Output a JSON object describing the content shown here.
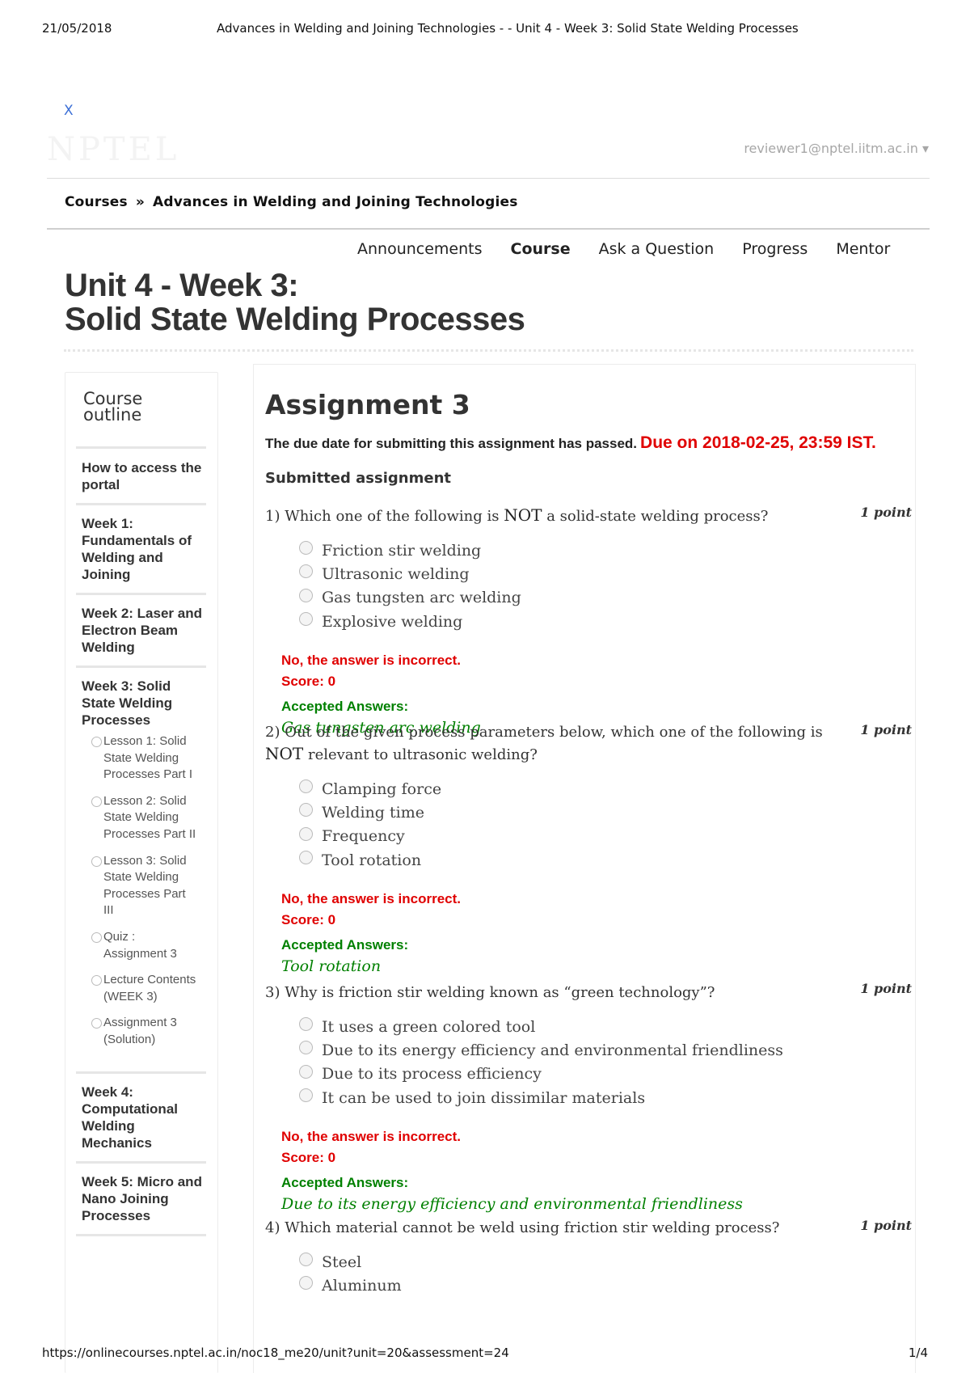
{
  "print_header": {
    "date": "21/05/2018",
    "title": "Advances in Welding and Joining Technologies - - Unit 4 - Week 3: Solid State Welding Processes"
  },
  "header": {
    "close": "X",
    "logo": "NPTEL",
    "user": "reviewer1@nptel.iitm.ac.in ▾"
  },
  "breadcrumb": {
    "root": "Courses",
    "sep": "»",
    "course": "Advances in Welding and Joining Technologies"
  },
  "nav": {
    "tabs": [
      "Announcements",
      "Course",
      "Ask a Question",
      "Progress",
      "Mentor"
    ],
    "active": "Course"
  },
  "page_title": {
    "line1": "Unit 4 - Week 3:",
    "line2": "Solid State Welding Processes"
  },
  "sidebar": {
    "title_line1": "Course",
    "title_line2": "outline",
    "items": [
      {
        "label": "How to access the portal"
      },
      {
        "label": "Week 1: Fundamentals of Welding and Joining"
      },
      {
        "label": "Week 2: Laser and Electron Beam Welding"
      },
      {
        "label": "Week 3: Solid State Welding Processes"
      },
      {
        "label": "Week 4: Computational Welding Mechanics"
      },
      {
        "label": "Week 5: Micro and Nano Joining Processes"
      }
    ],
    "week3_lessons": [
      "Lesson 1: Solid State Welding Processes Part I",
      "Lesson 2: Solid State Welding Processes Part II",
      "Lesson 3: Solid State Welding Processes Part III",
      "Quiz : Assignment 3",
      "Lecture Contents (WEEK 3)",
      "Assignment 3 (Solution)"
    ]
  },
  "assignment": {
    "heading": "Assignment 3",
    "due_passed": "The due date for submitting this assignment has passed.",
    "due_date": "Due on 2018-02-25, 23:59 IST.",
    "submitted": "Submitted assignment",
    "incorrect": "No, the answer is incorrect.",
    "score": "Score: 0",
    "accepted_label": "Accepted Answers:",
    "questions": [
      {
        "pre": "1) Which one of the following is ",
        "em": "NOT",
        "post": " a solid-state welding process?",
        "points": "1 point",
        "options": [
          "Friction stir welding",
          "Ultrasonic welding",
          "Gas tungsten arc welding",
          "Explosive welding"
        ],
        "answer": "Gas tungsten arc welding"
      },
      {
        "pre": "2) Out of the given process parameters below, which one of the following is ",
        "em": "NOT",
        "post": " relevant to ultrasonic welding?",
        "points": "1 point",
        "options": [
          "Clamping force",
          "Welding time",
          "Frequency",
          "Tool rotation"
        ],
        "answer": "Tool rotation"
      },
      {
        "pre": "3) Why is friction stir welding known as “green technology”?",
        "em": "",
        "post": "",
        "points": "1 point",
        "options": [
          "It uses a green colored tool",
          "Due to its energy efficiency and environmental friendliness",
          "Due to its process efficiency",
          "It can be used to join dissimilar materials"
        ],
        "answer": "Due to its energy efficiency and environmental friendliness"
      },
      {
        "pre": "4) Which material cannot be weld using friction stir welding process?",
        "em": "",
        "post": "",
        "points": "1 point",
        "options": [
          "Steel",
          "Aluminum"
        ]
      }
    ]
  },
  "print_footer": {
    "url": "https://onlinecourses.nptel.ac.in/noc18_me20/unit?unit=20&assessment=24",
    "page": "1/4"
  }
}
